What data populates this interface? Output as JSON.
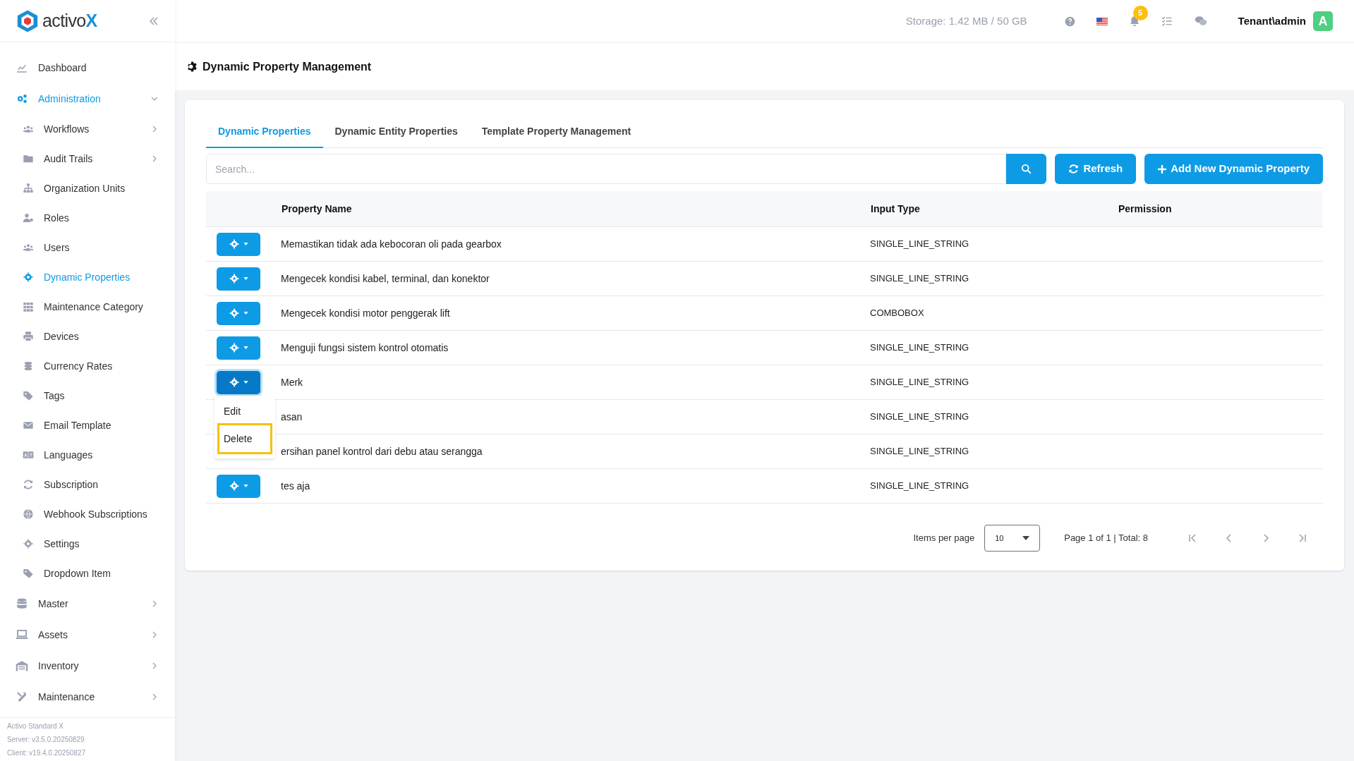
{
  "brand": {
    "name": "activo",
    "accent": "X"
  },
  "sidebar": {
    "items": [
      {
        "label": "Dashboard",
        "selected": false
      },
      {
        "label": "Administration",
        "selected": true,
        "expanded": true,
        "children": [
          {
            "label": "Workflows",
            "selected": false,
            "expanded": false
          },
          {
            "label": "Audit Trails",
            "selected": false,
            "expanded": false
          },
          {
            "label": "Organization Units",
            "selected": false
          },
          {
            "label": "Roles",
            "selected": false
          },
          {
            "label": "Users",
            "selected": false
          },
          {
            "label": "Dynamic Properties",
            "selected": true
          },
          {
            "label": "Maintenance Category",
            "selected": false
          },
          {
            "label": "Devices",
            "selected": false
          },
          {
            "label": "Currency Rates",
            "selected": false
          },
          {
            "label": "Tags",
            "selected": false
          },
          {
            "label": "Email Template",
            "selected": false
          },
          {
            "label": "Languages",
            "selected": false
          },
          {
            "label": "Subscription",
            "selected": false
          },
          {
            "label": "Webhook Subscriptions",
            "selected": false
          },
          {
            "label": "Settings",
            "selected": false
          },
          {
            "label": "Dropdown Item",
            "selected": false
          }
        ]
      },
      {
        "label": "Master",
        "selected": false,
        "expanded": false
      },
      {
        "label": "Assets",
        "selected": false,
        "expanded": false
      },
      {
        "label": "Inventory",
        "selected": false,
        "expanded": false
      },
      {
        "label": "Maintenance",
        "selected": false,
        "expanded": false
      }
    ],
    "footer": [
      "Activo Standard X",
      "Server: v3.5.0.20250829",
      "Client: v19.4.0.20250827"
    ]
  },
  "topbar": {
    "storage": "Storage: 1.42 MB / 50 GB",
    "notification_count": "5",
    "user": "Tenant\\admin",
    "avatar": "A"
  },
  "page_title": "Dynamic Property Management",
  "tabs": [
    {
      "label": "Dynamic Properties",
      "selected": true
    },
    {
      "label": "Dynamic Entity Properties",
      "selected": false
    },
    {
      "label": "Template Property Management",
      "selected": false
    }
  ],
  "search": {
    "placeholder": "Search..."
  },
  "buttons": {
    "refresh": "Refresh",
    "add": "Add New Dynamic Property"
  },
  "table": {
    "columns": [
      "Property Name",
      "Input Type",
      "Permission"
    ],
    "rows": [
      {
        "name": "Memastikan tidak ada kebocoran oli pada gearbox",
        "input_type": "SINGLE_LINE_STRING",
        "menu_open": false
      },
      {
        "name": "Mengecek kondisi kabel, terminal, dan konektor",
        "input_type": "SINGLE_LINE_STRING",
        "menu_open": false
      },
      {
        "name": "Mengecek kondisi motor penggerak lift",
        "input_type": "COMBOBOX",
        "menu_open": false
      },
      {
        "name": "Menguji fungsi sistem kontrol otomatis",
        "input_type": "SINGLE_LINE_STRING",
        "menu_open": false
      },
      {
        "name": "Merk",
        "input_type": "SINGLE_LINE_STRING",
        "menu_open": true
      },
      {
        "name": "asan",
        "input_type": "SINGLE_LINE_STRING",
        "menu_open": false,
        "button_hidden": true
      },
      {
        "name": "ersihan panel kontrol dari debu atau serangga",
        "input_type": "SINGLE_LINE_STRING",
        "menu_open": false,
        "button_hidden": true
      },
      {
        "name": "tes aja",
        "input_type": "SINGLE_LINE_STRING",
        "menu_open": false
      }
    ]
  },
  "row_menu": {
    "items": [
      {
        "label": "Edit",
        "highlighted": false
      },
      {
        "label": "Delete",
        "highlighted": true
      }
    ]
  },
  "pagination": {
    "items_per_page_label": "Items per page",
    "page_size": "10",
    "summary": "Page 1 of 1 | Total: 8"
  }
}
